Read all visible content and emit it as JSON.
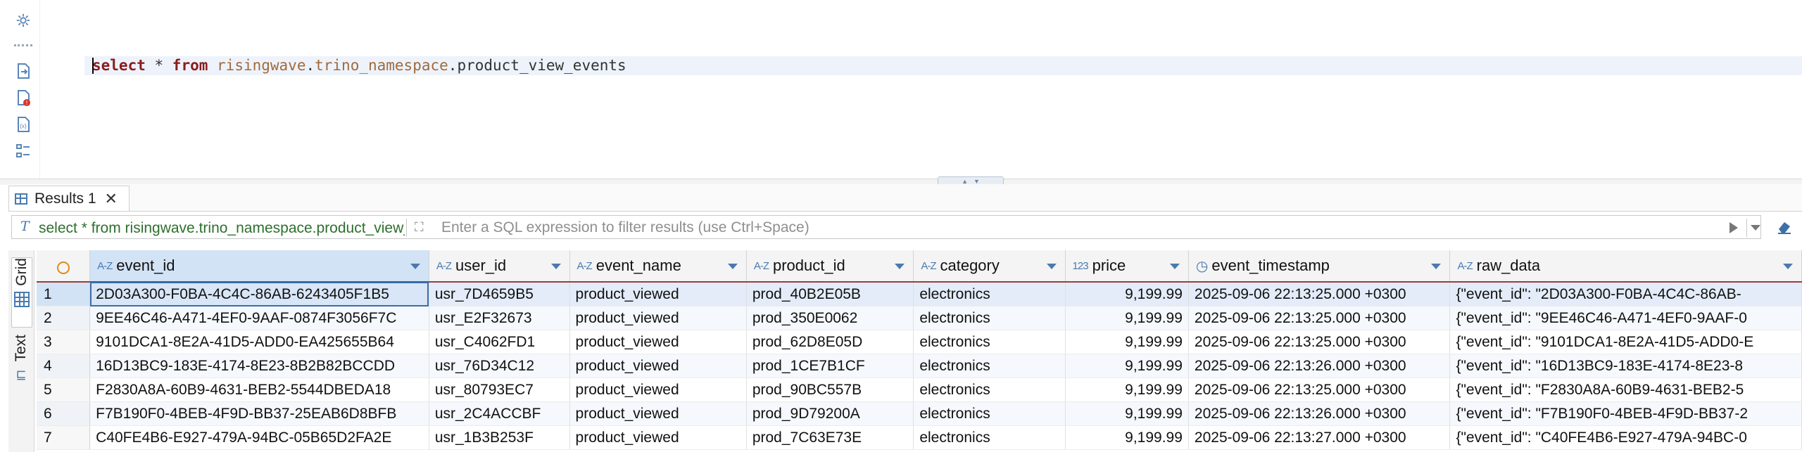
{
  "editor": {
    "query_tokens": [
      {
        "text": "select",
        "kind": "kw"
      },
      {
        "text": " * ",
        "kind": "plain"
      },
      {
        "text": "from",
        "kind": "kw"
      },
      {
        "text": " ",
        "kind": "plain"
      },
      {
        "text": "risingwave",
        "kind": "ident"
      },
      {
        "text": ".",
        "kind": "plain"
      },
      {
        "text": "trino_namespace",
        "kind": "ident"
      },
      {
        "text": ".",
        "kind": "plain"
      },
      {
        "text": "product_view_events",
        "kind": "plain"
      }
    ]
  },
  "gutter_icons": [
    "gear-icon",
    "execute-script-icon",
    "script-error-icon",
    "explain-plan-icon",
    "outline-icon"
  ],
  "results": {
    "tab_label": "Results 1",
    "filter_query": "select * from risingwave.trino_namespace.product_view_events",
    "filter_placeholder": "Enter a SQL expression to filter results (use Ctrl+Space)",
    "side_tabs": {
      "grid": "Grid",
      "text": "Text"
    }
  },
  "table": {
    "columns": [
      {
        "type": "A-Z",
        "name": "event_id"
      },
      {
        "type": "A-Z",
        "name": "user_id"
      },
      {
        "type": "A-Z",
        "name": "event_name"
      },
      {
        "type": "A-Z",
        "name": "product_id"
      },
      {
        "type": "A-Z",
        "name": "category"
      },
      {
        "type": "123",
        "name": "price"
      },
      {
        "type": "clock",
        "name": "event_timestamp"
      },
      {
        "type": "A-Z",
        "name": "raw_data"
      }
    ],
    "rows": [
      [
        "1",
        "2D03A300-F0BA-4C4C-86AB-6243405F1B5",
        "usr_7D4659B5",
        "product_viewed",
        "prod_40B2E05B",
        "electronics",
        "9,199.99",
        "2025-09-06 22:13:25.000 +0300",
        "{\"event_id\": \"2D03A300-F0BA-4C4C-86AB-"
      ],
      [
        "2",
        "9EE46C46-A471-4EF0-9AAF-0874F3056F7C",
        "usr_E2F32673",
        "product_viewed",
        "prod_350E0062",
        "electronics",
        "9,199.99",
        "2025-09-06 22:13:25.000 +0300",
        "{\"event_id\": \"9EE46C46-A471-4EF0-9AAF-0"
      ],
      [
        "3",
        "9101DCA1-8E2A-41D5-ADD0-EA425655B64",
        "usr_C4062FD1",
        "product_viewed",
        "prod_62D8E05D",
        "electronics",
        "9,199.99",
        "2025-09-06 22:13:25.000 +0300",
        "{\"event_id\": \"9101DCA1-8E2A-41D5-ADD0-E"
      ],
      [
        "4",
        "16D13BC9-183E-4174-8E23-8B2B82BCCDD",
        "usr_76D34C12",
        "product_viewed",
        "prod_1CE7B1CF",
        "electronics",
        "9,199.99",
        "2025-09-06 22:13:26.000 +0300",
        "{\"event_id\": \"16D13BC9-183E-4174-8E23-8"
      ],
      [
        "5",
        "F2830A8A-60B9-4631-BEB2-5544DBEDA18",
        "usr_80793EC7",
        "product_viewed",
        "prod_90BC557B",
        "electronics",
        "9,199.99",
        "2025-09-06 22:13:25.000 +0300",
        "{\"event_id\": \"F2830A8A-60B9-4631-BEB2-5"
      ],
      [
        "6",
        "F7B190F0-4BEB-4F9D-BB37-25EAB6D8BFB",
        "usr_2C4ACCBF",
        "product_viewed",
        "prod_9D79200A",
        "electronics",
        "9,199.99",
        "2025-09-06 22:13:26.000 +0300",
        "{\"event_id\": \"F7B190F0-4BEB-4F9D-BB37-2"
      ],
      [
        "7",
        "C40FE4B6-E927-479A-94BC-05B65D2FA2E",
        "usr_1B3B253F",
        "product_viewed",
        "prod_7C63E73E",
        "electronics",
        "9,199.99",
        "2025-09-06 22:13:27.000 +0300",
        "{\"event_id\": \"C40FE4B6-E927-479A-94BC-0"
      ]
    ]
  }
}
